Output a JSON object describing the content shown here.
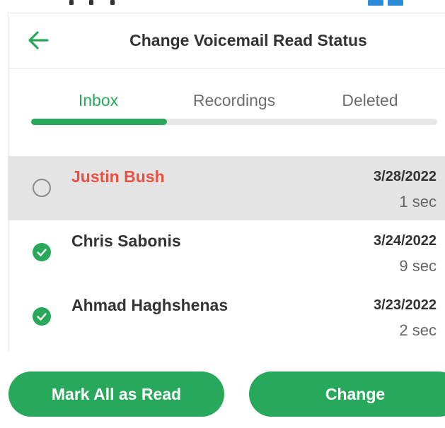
{
  "header": {
    "title": "Change Voicemail Read Status",
    "back_icon": "arrow-left-icon"
  },
  "tabs": [
    {
      "label": "Inbox",
      "active": true
    },
    {
      "label": "Recordings",
      "active": false
    },
    {
      "label": "Deleted",
      "active": false
    }
  ],
  "voicemails": [
    {
      "name": "Justin Bush",
      "date": "3/28/2022",
      "duration": "1 sec",
      "read": false,
      "selected": true
    },
    {
      "name": "Chris Sabonis",
      "date": "3/24/2022",
      "duration": "9 sec",
      "read": true,
      "selected": false
    },
    {
      "name": "Ahmad Haghshenas",
      "date": "3/23/2022",
      "duration": "2 sec",
      "read": true,
      "selected": false
    }
  ],
  "footer": {
    "mark_all_label": "Mark All as Read",
    "change_label": "Change"
  },
  "colors": {
    "accent": "#27a85a",
    "unread_name": "#e9503f",
    "selected_row": "#e4e4e4"
  }
}
